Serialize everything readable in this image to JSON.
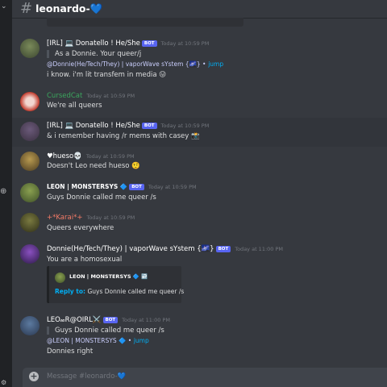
{
  "channel": {
    "hash": "#",
    "title": "leonardo-💙"
  },
  "composer": {
    "plus": "+",
    "placeholder": "Message #leonardo-💙"
  },
  "messages": [
    {
      "user": "[IRL] 💻 Donatello ! He/She",
      "bot": "BOT",
      "time": "Today at 10:59 PM",
      "reply": "As a Donnie. Your queer/j",
      "mention": "@Donnie(He/Tech/They) | vaporWave sYstem {🌌} •",
      "jump": "jump",
      "text": "i know. i'm lit transfem in media 😛"
    },
    {
      "user": "CursedCat",
      "time": "Today at 10:59 PM",
      "text": "We're all queers"
    },
    {
      "user": "[IRL] 💻 Donatello ! He/She",
      "bot": "BOT",
      "time": "Today at 10:59 PM",
      "text": "& i remember having /r mems with casey 📸"
    },
    {
      "user": "♥hueso💀",
      "time": "Today at 10:59 PM",
      "text": "Doesn't Leo need hueso 🤨"
    },
    {
      "user": "LEON | MONSTERSYS 🔷",
      "bot": "BOT",
      "time": "Today at 10:59 PM",
      "text": "Guys Donnie called me queer /s"
    },
    {
      "user": "+*Karai*+",
      "time": "Today at 10:59 PM",
      "text": "Queers everywhere"
    },
    {
      "user": "Donnie(He/Tech/They) | vaporWave sYstem {🌌}",
      "bot": "BOT",
      "time": "Today at 11:00 PM",
      "text": "You are a homosexual",
      "embed": {
        "author": "LEON | MONSTERSYS 🔷 ↩️",
        "reply_label": "Reply to:",
        "reply_text": "Guys Donnie called me queer /s"
      }
    },
    {
      "user": "LEO𝓌R@OIRL⚔️",
      "bot": "BOT",
      "time": "Today at 11:00 PM",
      "reply": "Guys Donnie called me queer /s",
      "mention": "@LEON | MONSTERSYS 🔷 •",
      "jump": "jump",
      "text": "Donnies right"
    }
  ],
  "colors": {
    "background": "#36393f",
    "sidebar": "#202225",
    "bot_badge": "#5865f2",
    "cursedcat_name": "#3ba55d",
    "karai_name": "#f47b67",
    "link": "#00aff4"
  },
  "icons": {
    "channel": "hash-icon",
    "add": "plus-icon"
  }
}
